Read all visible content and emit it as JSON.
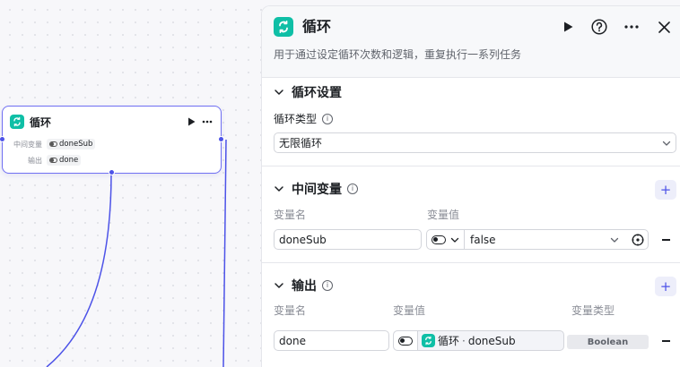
{
  "node": {
    "title": "循环",
    "rows": [
      {
        "label": "中间变量",
        "value": "doneSub"
      },
      {
        "label": "输出",
        "value": "done"
      }
    ]
  },
  "panel": {
    "title": "循环",
    "description": "用于通过设定循环次数和逻辑，重复执行一系列任务",
    "loop_settings": {
      "title": "循环设置",
      "type_label": "循环类型",
      "type_value": "无限循环"
    },
    "intermediate": {
      "title": "中间变量",
      "name_header": "变量名",
      "value_header": "变量值",
      "name_value": "doneSub",
      "value_value": "false"
    },
    "output": {
      "title": "输出",
      "name_header": "变量名",
      "value_header": "变量值",
      "type_header": "变量类型",
      "name_value": "done",
      "ref_node": "循环",
      "ref_sep": "·",
      "ref_var": "doneSub",
      "type_value": "Boolean"
    }
  },
  "colors": {
    "accent": "#4d53e8",
    "node_icon": "#0fbfa6"
  }
}
